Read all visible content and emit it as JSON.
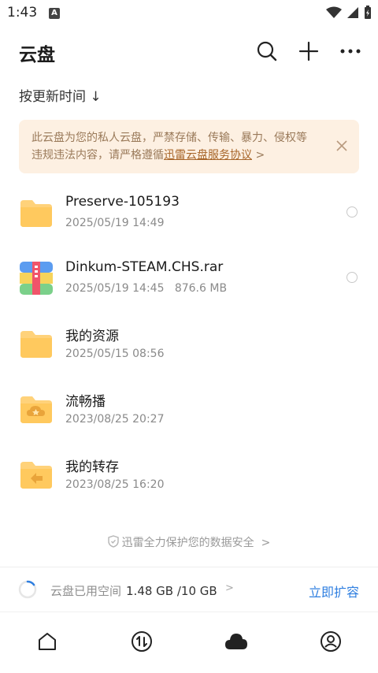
{
  "status_bar": {
    "time": "1:43",
    "notification_icon": "A"
  },
  "header": {
    "title": "云盘",
    "icons": [
      "search-icon",
      "plus-icon",
      "more-icon"
    ]
  },
  "sort": {
    "label": "按更新时间 ↓"
  },
  "notice": {
    "text": "此云盘为您的私人云盘，严禁存储、传输、暴力、侵权等违规违法内容，请严格遵循",
    "link": "迅雷云盘服务协议",
    "suffix": " >"
  },
  "files": [
    {
      "name": "Preserve-105193",
      "meta": "2025/05/19 14:49",
      "icon": "folder-icon"
    },
    {
      "name": "Dinkum-STEAM.CHS.rar",
      "meta": "2025/05/19 14:45   876.6 MB",
      "icon": "archive-icon"
    },
    {
      "name": "我的资源",
      "meta": "2025/05/15 08:56",
      "icon": "folder-icon"
    },
    {
      "name": "流畅播",
      "meta": "2023/08/25 20:27",
      "icon": "cloud-folder-icon"
    },
    {
      "name": "我的转存",
      "meta": "2023/08/25 16:20",
      "icon": "transfer-folder-icon"
    }
  ],
  "security": {
    "text": "迅雷全力保护您的数据安全",
    "chevron": ">"
  },
  "storage": {
    "label": "云盘已用空间",
    "value": "1.48 GB /10 GB",
    "chevron": ">",
    "used_fraction": 0.148,
    "expand_label": "立即扩容",
    "accent": "#2f7fe0"
  },
  "tabbar": {
    "tabs": [
      "home-icon",
      "transfer-icon",
      "cloud-icon",
      "profile-icon"
    ],
    "active": "cloud-icon"
  }
}
